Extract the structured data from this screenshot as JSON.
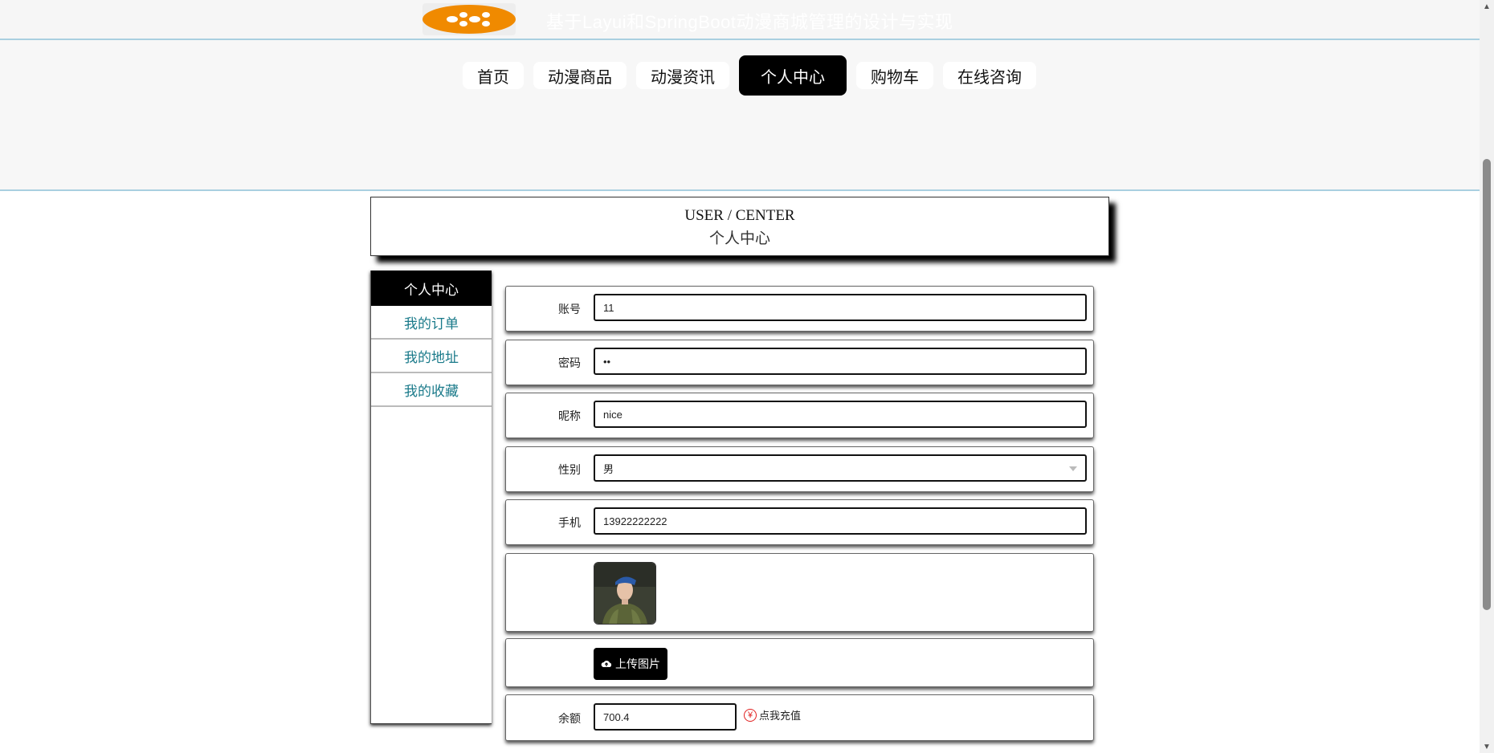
{
  "header": {
    "site_title": "基于Layui和SpringBoot动漫商城管理的设计与实现"
  },
  "nav": {
    "items": [
      {
        "label": "首页"
      },
      {
        "label": "动漫商品"
      },
      {
        "label": "动漫资讯"
      },
      {
        "label": "个人中心",
        "active": true
      },
      {
        "label": "购物车"
      },
      {
        "label": "在线咨询"
      }
    ]
  },
  "page_title": {
    "en": "USER / CENTER",
    "cn": "个人中心"
  },
  "sidebar": {
    "items": [
      {
        "label": "个人中心",
        "active": true
      },
      {
        "label": "我的订单"
      },
      {
        "label": "我的地址"
      },
      {
        "label": "我的收藏"
      }
    ]
  },
  "form": {
    "account_label": "账号",
    "account_value": "11",
    "password_label": "密码",
    "password_value": "••",
    "nickname_label": "昵称",
    "nickname_value": "nice",
    "gender_label": "性别",
    "gender_value": "男",
    "phone_label": "手机",
    "phone_value": "13922222222",
    "upload_label": "上传图片",
    "balance_label": "余额",
    "balance_value": "700.4",
    "recharge_label": "点我充值"
  },
  "colors": {
    "accent": "#000000",
    "link": "#1a7a8a",
    "logo": "#f08a00",
    "divider": "#a9cfe0"
  }
}
